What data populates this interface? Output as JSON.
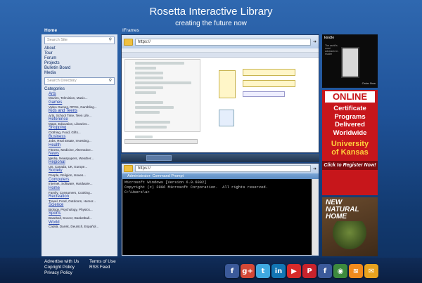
{
  "header": {
    "title": "Rosetta Interactive Library",
    "subtitle": "creating the future now"
  },
  "labels": {
    "home": "Home",
    "iframes": "IFrames"
  },
  "sidebar": {
    "search_site_placeholder": "Search Site",
    "links": [
      "About",
      "Tour",
      "Forum",
      "Projects",
      "Bulletin Board",
      "Media"
    ],
    "search_directory_placeholder": "Search Directory",
    "categories_heading": "Categories",
    "categories": [
      {
        "name": "Arts",
        "sub": "Movies, Television, Music..."
      },
      {
        "name": "Games",
        "sub": "Video Games, RPGs, Gambling..."
      },
      {
        "name": "Kids and Teens",
        "sub": "Arts, School Time, Teen Life..."
      },
      {
        "name": "Reference",
        "sub": "Maps, Education, Libraries..."
      },
      {
        "name": "Shopping",
        "sub": "Clothing, Food, Gifts..."
      },
      {
        "name": "Business",
        "sub": "Jobs, Real Estate, Investing..."
      },
      {
        "name": "Health",
        "sub": "Fitness, Medicine, Alternative..."
      },
      {
        "name": "News",
        "sub": "Media, Newspapers, Weather..."
      },
      {
        "name": "Regional",
        "sub": "US, Canada, UK, Europe..."
      },
      {
        "name": "Society",
        "sub": "People, Religion, Issues..."
      },
      {
        "name": "Computers",
        "sub": "Internet, Software, Hardware..."
      },
      {
        "name": "Home",
        "sub": "Family, Consumers, Cooking..."
      },
      {
        "name": "Recreation",
        "sub": "Travel, Food, Outdoors, Humor..."
      },
      {
        "name": "Science",
        "sub": "Biology, Psychology, Physics..."
      },
      {
        "name": "Sports",
        "sub": "Baseball, Soccer, Basketball..."
      },
      {
        "name": "World",
        "sub": "Català, Dansk, Deutsch, Español..."
      }
    ]
  },
  "iframe1": {
    "address": "https://"
  },
  "iframe2": {
    "address": "https://",
    "window_title": "Administrator: Command Prompt",
    "console_lines": [
      "Microsoft Windows [Version 6.0.6002]",
      "Copyright (c) 2006 Microsoft Corporation.  All rights reserved.",
      "",
      "C:\\Users\\a>"
    ]
  },
  "ads": {
    "kindle": {
      "brand": "kindle",
      "tagline": "The world's most advanced e-reader",
      "order": "Order Now"
    },
    "online": {
      "online": "ONLINE",
      "body": [
        "Certificate",
        "Programs",
        "Delivered",
        "Worldwide"
      ],
      "university": [
        "University",
        "of Kansas"
      ],
      "cta": "Click to Register Now!"
    },
    "home": {
      "title": [
        "NEW",
        "NATURAL",
        "HOME"
      ]
    }
  },
  "footer": {
    "col1": [
      "Advertise with Us",
      "Copright Policy",
      "Privacy Policy"
    ],
    "col2": [
      "Terms of Use",
      "RSS Feed"
    ]
  },
  "social_icons": [
    {
      "name": "facebook-icon",
      "glyph": "f",
      "color": "#3b5a9a"
    },
    {
      "name": "google-plus-icon",
      "glyph": "g+",
      "color": "#d34836"
    },
    {
      "name": "twitter-icon",
      "glyph": "t",
      "color": "#3fa9e0"
    },
    {
      "name": "linkedin-icon",
      "glyph": "in",
      "color": "#1276b4"
    },
    {
      "name": "youtube-icon",
      "glyph": "▶",
      "color": "#d62a2a"
    },
    {
      "name": "pinterest-icon",
      "glyph": "P",
      "color": "#c8232c"
    },
    {
      "name": "facebook-icon-2",
      "glyph": "f",
      "color": "#3b5a9a"
    },
    {
      "name": "globe-icon",
      "glyph": "◉",
      "color": "#3d8a3d"
    },
    {
      "name": "rss-icon",
      "glyph": "≋",
      "color": "#f08a1c"
    },
    {
      "name": "mail-icon",
      "glyph": "✉",
      "color": "#e6a21f"
    }
  ]
}
